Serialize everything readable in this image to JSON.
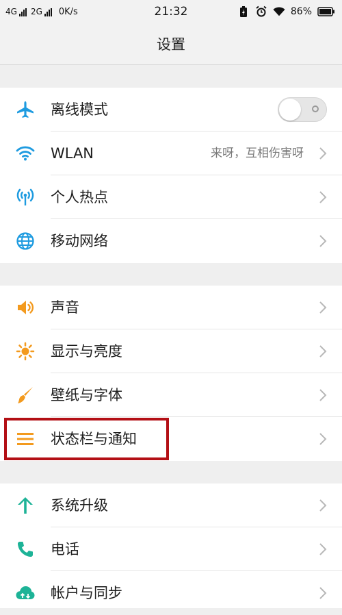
{
  "status_bar": {
    "net1": "4G",
    "net2": "2G",
    "speed": "0K/s",
    "time": "21:32",
    "battery": "86%"
  },
  "header": {
    "title": "设置"
  },
  "groups": [
    {
      "items": [
        {
          "label": "离线模式",
          "icon": "airplane-icon",
          "toggle": false
        },
        {
          "label": "WLAN",
          "icon": "wifi-icon",
          "value": "来呀，互相伤害呀"
        },
        {
          "label": "个人热点",
          "icon": "hotspot-icon"
        },
        {
          "label": "移动网络",
          "icon": "globe-icon"
        }
      ]
    },
    {
      "items": [
        {
          "label": "声音",
          "icon": "speaker-icon"
        },
        {
          "label": "显示与亮度",
          "icon": "sun-icon"
        },
        {
          "label": "壁纸与字体",
          "icon": "brush-icon"
        },
        {
          "label": "状态栏与通知",
          "icon": "menu-lines-icon"
        }
      ]
    },
    {
      "items": [
        {
          "label": "系统升级",
          "icon": "arrow-up-icon"
        },
        {
          "label": "电话",
          "icon": "phone-icon"
        },
        {
          "label": "帐户与同步",
          "icon": "cloud-sync-icon"
        }
      ]
    }
  ],
  "colors": {
    "blue": "#1e9be0",
    "orange": "#f39a1e",
    "teal": "#1db397",
    "highlight": "#b30f15"
  }
}
